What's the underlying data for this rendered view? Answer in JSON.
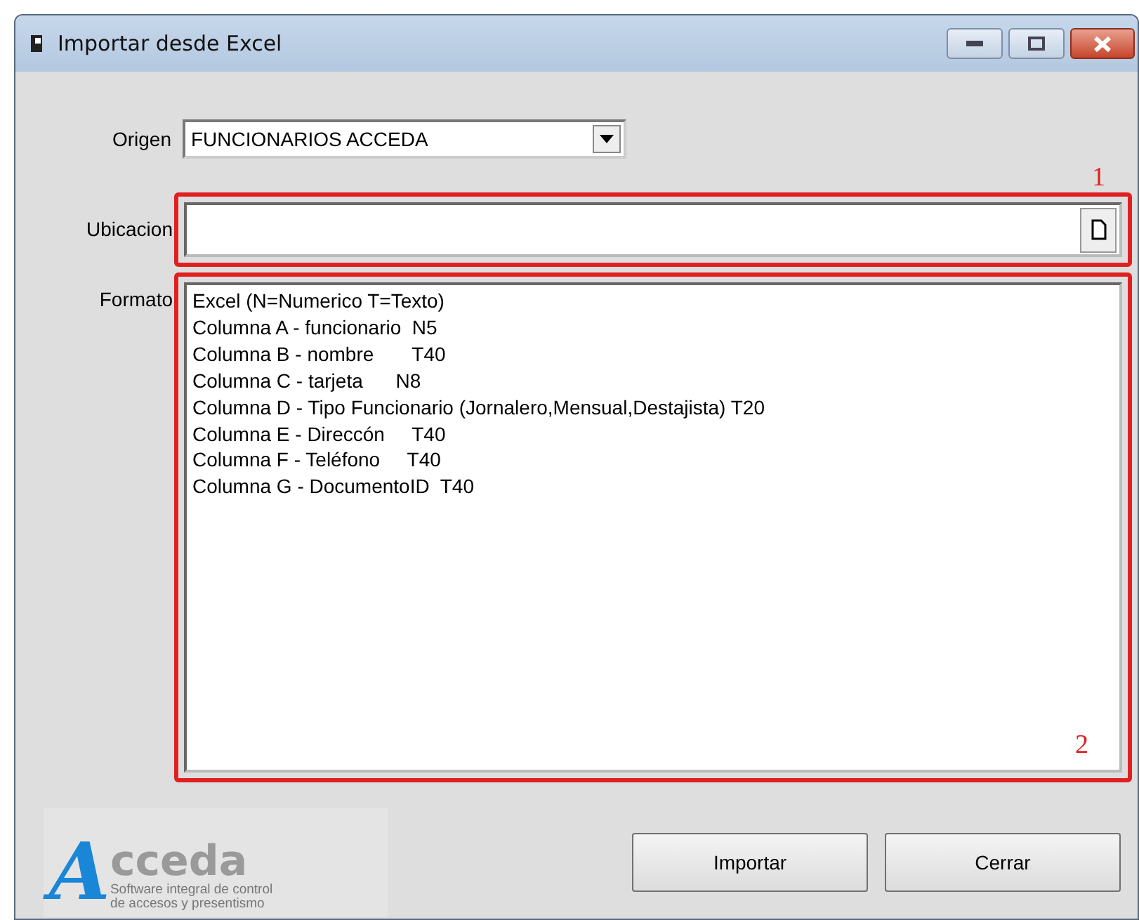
{
  "window": {
    "title": "Importar desde Excel"
  },
  "origen": {
    "label": "Origen",
    "value": "FUNCIONARIOS ACCEDA"
  },
  "ubicacion": {
    "label": "Ubicacion",
    "annotation": "1"
  },
  "formato": {
    "label": "Formato",
    "annotation": "2",
    "lines": [
      "Excel (N=Numerico T=Texto)",
      "Columna A - funcionario  N5",
      "Columna B - nombre       T40",
      "Columna C - tarjeta      N8",
      "Columna D - Tipo Funcionario (Jornalero,Mensual,Destajista) T20",
      "Columna E - Direccón     T40",
      "Columna F - Teléfono     T40",
      "Columna G - DocumentoID  T40"
    ]
  },
  "logo": {
    "initial": "A",
    "rest": "cceda",
    "tagline": [
      "Software integral de control",
      "de accesos y presentismo"
    ]
  },
  "buttons": [
    "Importar",
    "Cerrar"
  ]
}
